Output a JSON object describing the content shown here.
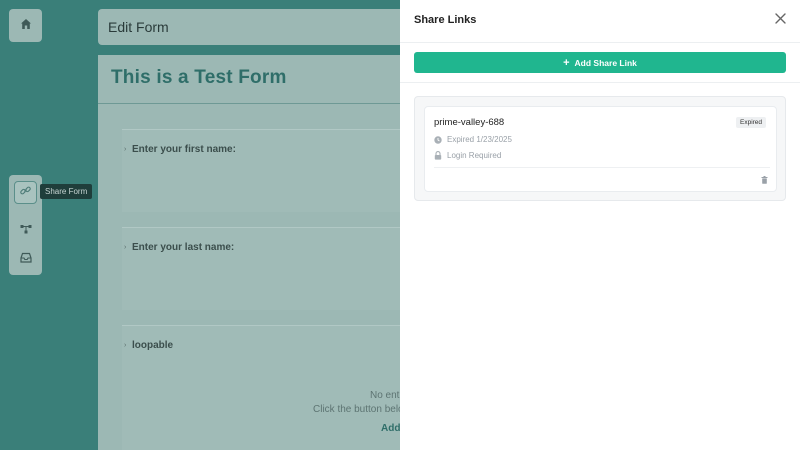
{
  "background": {
    "topbar_title": "Edit Form",
    "form_title": "This is a Test Form",
    "fields": [
      {
        "label": "Enter your first name:"
      },
      {
        "label": "Enter your last name:"
      },
      {
        "label": "loopable"
      }
    ],
    "empty_state": {
      "line1": "No ent",
      "line2": "Click the button belo",
      "action": "Add"
    },
    "sidebar": {
      "tooltip": "Share Form",
      "icons": [
        "home-icon",
        "share-link-icon",
        "workflow-icon",
        "inbox-icon"
      ]
    }
  },
  "drawer": {
    "title": "Share Links",
    "add_button_label": "Add Share Link",
    "links": [
      {
        "name": "prime-valley-688",
        "status": "Expired",
        "expiry": "Expired 1/23/2025",
        "access": "Login Required"
      }
    ]
  },
  "colors": {
    "accent": "#20b68f",
    "backdrop": "#2f6662",
    "form_title": "#2f6e69"
  }
}
